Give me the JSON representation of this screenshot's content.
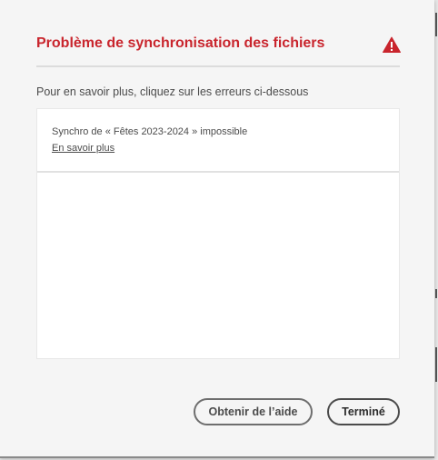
{
  "dialog": {
    "title": "Problème de synchronisation des fichiers",
    "title_color": "#c9252d",
    "icon": "warning-icon",
    "subtitle": "Pour en savoir plus, cliquez sur les erreurs ci-dessous"
  },
  "errors": [
    {
      "message": "Synchro de « Fêtes 2023-2024 » impossible",
      "link_label": "En savoir plus"
    }
  ],
  "buttons": {
    "help_label": "Obtenir de l’aide",
    "done_label": "Terminé"
  }
}
